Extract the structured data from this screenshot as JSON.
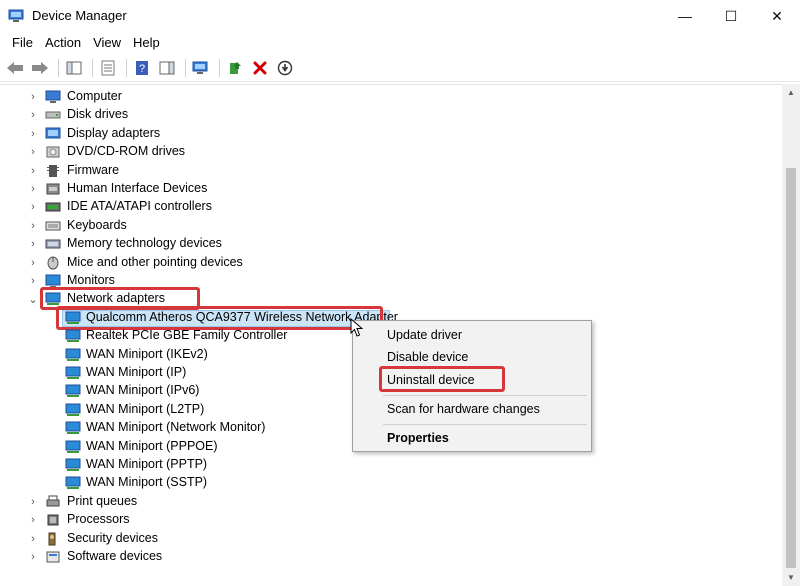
{
  "window": {
    "title": "Device Manager",
    "minimize_glyph": "—",
    "maximize_glyph": "☐",
    "close_glyph": "✕"
  },
  "menu": {
    "file": "File",
    "action": "Action",
    "view": "View",
    "help": "Help"
  },
  "toolbar": {
    "buttons": [
      "back-icon",
      "forward-icon",
      "show-hide-console-tree-icon",
      "properties-icon",
      "help-icon",
      "action-pane-icon",
      "scan-hardware-icon",
      "update-driver-icon",
      "uninstall-icon",
      "disable-device-icon"
    ]
  },
  "tree": {
    "categories_top": [
      {
        "label": "Computer",
        "icon": "computer-icon"
      },
      {
        "label": "Disk drives",
        "icon": "disk-drive-icon"
      },
      {
        "label": "Display adapters",
        "icon": "display-adapter-icon"
      },
      {
        "label": "DVD/CD-ROM drives",
        "icon": "dvd-drive-icon"
      },
      {
        "label": "Firmware",
        "icon": "firmware-icon"
      },
      {
        "label": "Human Interface Devices",
        "icon": "hid-icon"
      },
      {
        "label": "IDE ATA/ATAPI controllers",
        "icon": "ide-controller-icon"
      },
      {
        "label": "Keyboards",
        "icon": "keyboard-icon"
      },
      {
        "label": "Memory technology devices",
        "icon": "memory-icon"
      },
      {
        "label": "Mice and other pointing devices",
        "icon": "mouse-icon"
      },
      {
        "label": "Monitors",
        "icon": "monitor-icon"
      }
    ],
    "expanded_category": {
      "label": "Network adapters",
      "icon": "network-adapter-icon"
    },
    "network_children": [
      "Qualcomm Atheros QCA9377 Wireless Network Adapter",
      "Realtek PCIe GBE Family Controller",
      "WAN Miniport (IKEv2)",
      "WAN Miniport (IP)",
      "WAN Miniport (IPv6)",
      "WAN Miniport (L2TP)",
      "WAN Miniport (Network Monitor)",
      "WAN Miniport (PPPOE)",
      "WAN Miniport (PPTP)",
      "WAN Miniport (SSTP)"
    ],
    "categories_bottom": [
      {
        "label": "Print queues",
        "icon": "printer-icon"
      },
      {
        "label": "Processors",
        "icon": "processor-icon"
      },
      {
        "label": "Security devices",
        "icon": "security-device-icon"
      },
      {
        "label": "Software devices",
        "icon": "software-device-icon"
      }
    ]
  },
  "context_menu": {
    "update_driver": "Update driver",
    "disable_device": "Disable device",
    "uninstall_device": "Uninstall device",
    "scan_hardware": "Scan for hardware changes",
    "properties": "Properties"
  },
  "colors": {
    "highlight": "#d6373a",
    "selection": "#cce4f7",
    "close_red": "#d40000"
  }
}
